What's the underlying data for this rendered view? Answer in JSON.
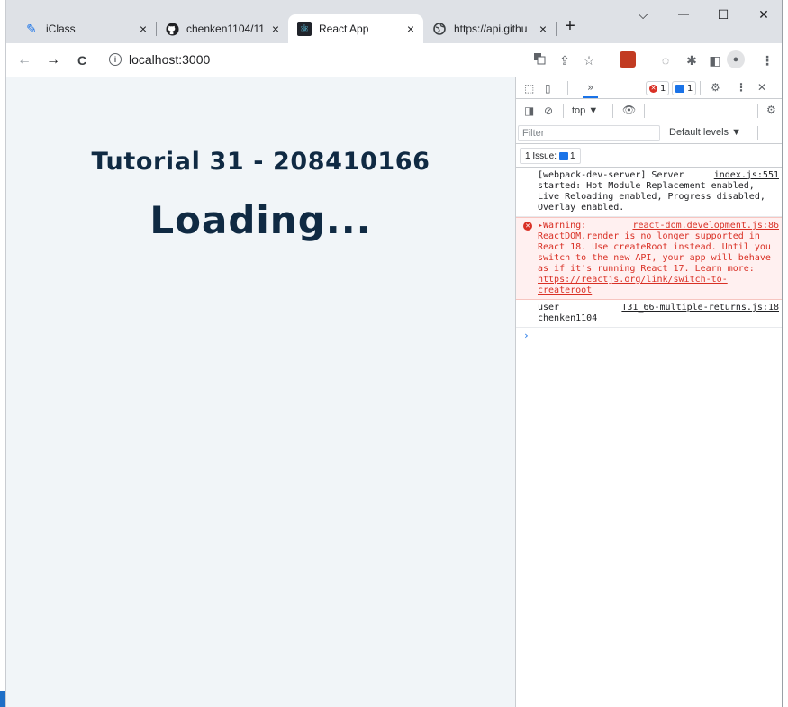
{
  "browser": {
    "tabs": [
      {
        "title": "iClass",
        "close": "×",
        "favicon": "iclass-icon"
      },
      {
        "title": "chenken1104/11",
        "close": "×",
        "favicon": "github-icon"
      },
      {
        "title": "React App",
        "close": "×",
        "favicon": "react-icon"
      },
      {
        "title": "https://api.githu",
        "close": "×",
        "favicon": "globe-icon"
      }
    ],
    "new_tab": "+",
    "window_controls": {
      "dropdown": "⌵",
      "minimize": "—",
      "maximize": "☐",
      "close": "✕"
    },
    "nav": {
      "back": "←",
      "forward": "→",
      "reload": "C"
    },
    "address": "localhost:3000",
    "info_glyph": "i"
  },
  "page": {
    "subtitle": "Tutorial 31 - 208410166",
    "title": "Loading..."
  },
  "devtools": {
    "more_tabs": "»",
    "error_count": "1",
    "info_count": "1",
    "context": "top ▼",
    "filter_placeholder": "Filter",
    "levels": "Default levels ▼",
    "issues_label": "1 Issue:",
    "issues_count": "1",
    "messages": [
      {
        "type": "log",
        "source": "index.js:551",
        "text": "[webpack-dev-server] Server started: Hot Module Replacement enabled, Live Reloading enabled, Progress disabled, Overlay enabled."
      },
      {
        "type": "warning",
        "source": "react-dom.development.js:86",
        "text": "▸Warning: ReactDOM.render is no longer supported in React 18. Use createRoot instead. Until you switch to the new API, your app will behave as if it's running React 17. Learn more: ",
        "link": "https://reactjs.org/link/switch-to-createroot"
      },
      {
        "type": "log",
        "source": "T31_66-multiple-returns.js:18",
        "text": "user\nchenken1104"
      }
    ],
    "prompt": "›"
  },
  "colors": {
    "page_bg": "#f1f5f8",
    "heading": "#102a43",
    "warning_text": "#d93025",
    "warning_bg": "#fff0f0"
  }
}
